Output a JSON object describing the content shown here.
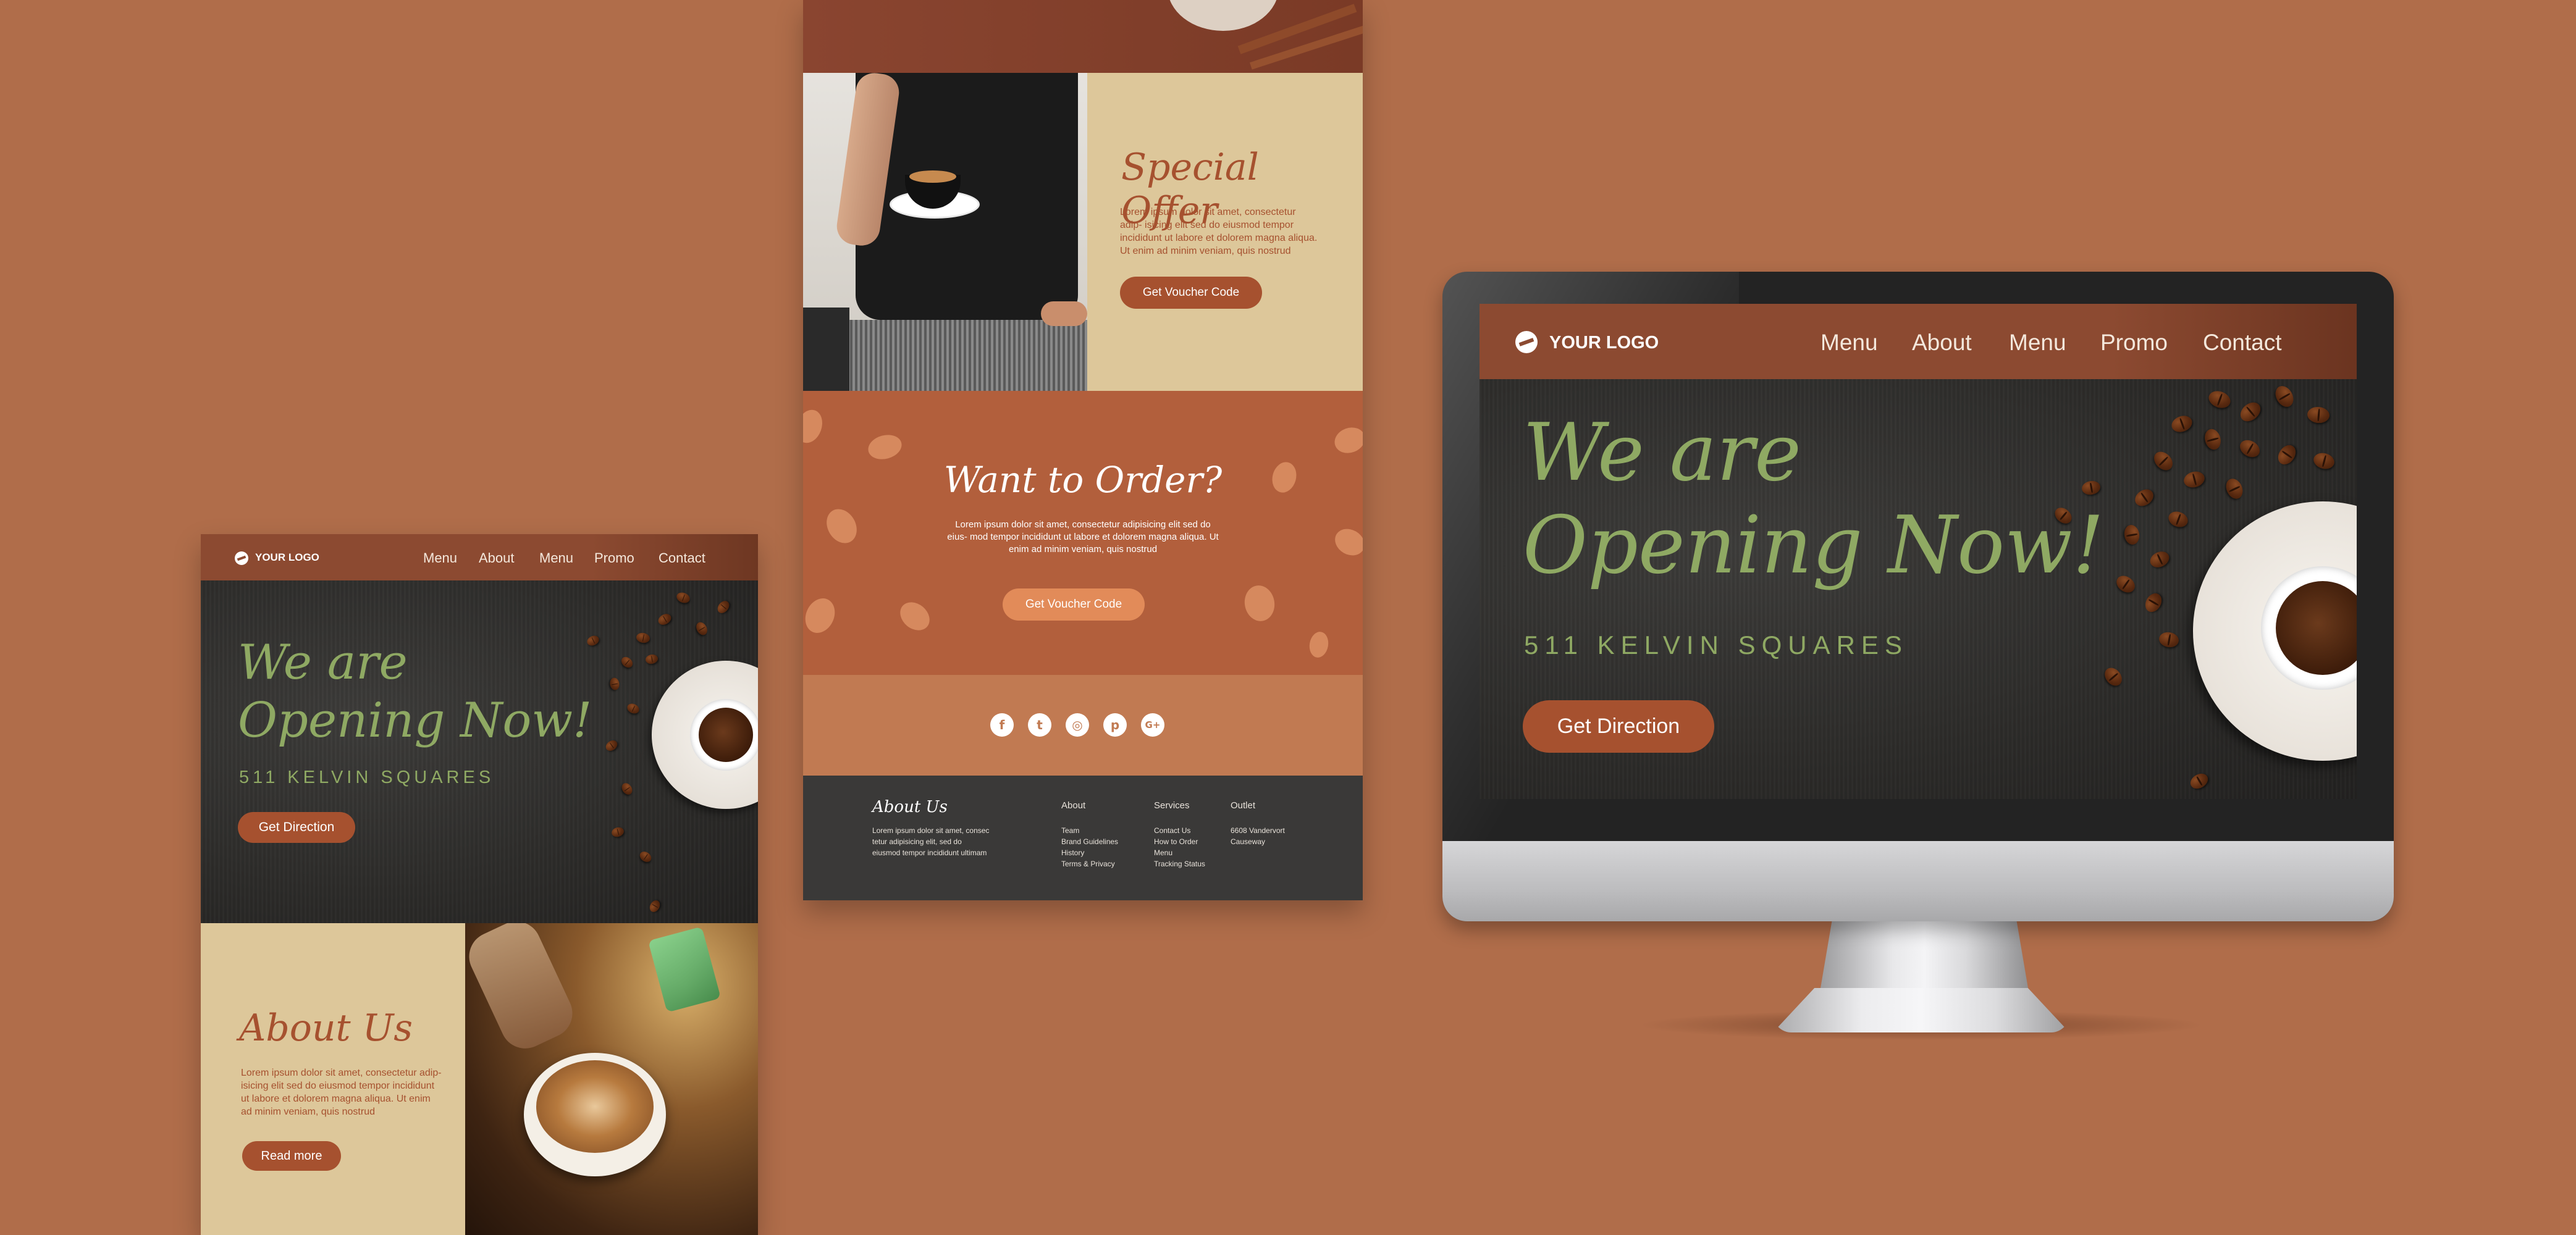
{
  "brand": {
    "logo_text": "YOUR LOGO"
  },
  "nav": [
    "Menu",
    "About",
    "Menu",
    "Promo",
    "Contact"
  ],
  "hero": {
    "title_line1": "We are",
    "title_line2": "Opening Now!",
    "address": "511 KELVIN SQUARES",
    "cta": "Get Direction"
  },
  "about": {
    "title": "About Us",
    "body": "Lorem ipsum dolor sit amet, consectetur adip- isicing elit sed do eiusmod tempor incididunt ut labore et dolorem magna aliqua. Ut enim ad minim veniam, quis nostrud",
    "cta": "Read more"
  },
  "special_offer": {
    "title": "Special Offer",
    "body": "Lorem ipsum dolor sit amet, consectetur adip- isicing elit sed do eiusmod tempor incididunt ut labore et dolorem magna aliqua. Ut enim ad minim veniam, quis nostrud",
    "cta": "Get Voucher Code"
  },
  "order": {
    "title": "Want to Order?",
    "body": "Lorem ipsum dolor sit amet, consectetur adipisicing elit sed do eius- mod tempor incididunt ut labore et dolorem magna aliqua. Ut enim ad minim veniam, quis nostrud",
    "cta": "Get Voucher Code"
  },
  "social_icons": [
    "facebook-icon",
    "twitter-icon",
    "instagram-icon",
    "pinterest-icon",
    "google-plus-icon"
  ],
  "footer": {
    "about_title": "About Us",
    "about_text": "Lorem ipsum dolor sit amet, consec tetur adipisicing elit, sed do eiusmod tempor incididunt ultimam",
    "col_about": {
      "title": "About",
      "items": [
        "Team",
        "Brand Guidelines",
        "History",
        "Terms & Privacy"
      ]
    },
    "col_services": {
      "title": "Services",
      "items": [
        "Contact Us",
        "How to Order",
        "Menu",
        "Tracking Status"
      ]
    },
    "col_outlet": {
      "title": "Outlet",
      "items": [
        "6608 Vandervort",
        "Causeway"
      ]
    }
  },
  "colors": {
    "background": "#b06d4a",
    "header": "#8c4a31",
    "accent_green": "#8fa963",
    "button": "#a6512f",
    "cream": "#ddc79a",
    "order_bg": "#b25f3c",
    "footer_bg": "#3a3938"
  }
}
